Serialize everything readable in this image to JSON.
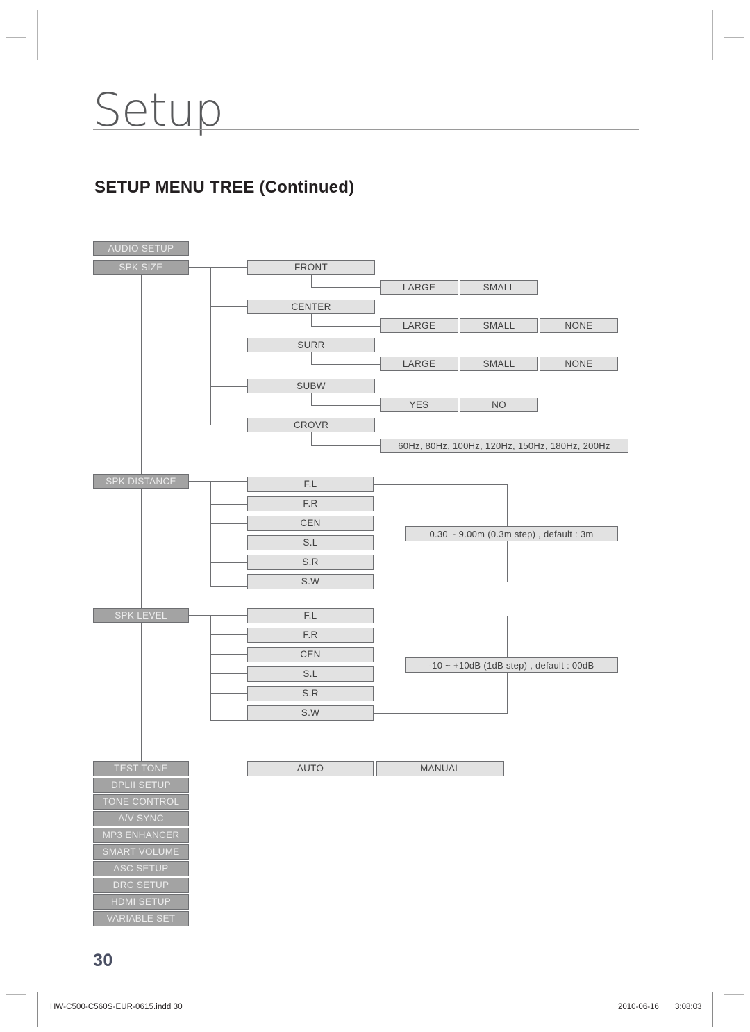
{
  "page": {
    "title": "Setup",
    "section_heading": "SETUP MENU TREE (Continued)",
    "number": "30"
  },
  "footer": {
    "file": "HW-C500-C560S-EUR-0615.indd   30",
    "date": "2010-06-16",
    "time": "3:08:03"
  },
  "colors": {
    "node_dark_fill": "#a3a3a3",
    "node_dark_text": "#ededed",
    "node_light_fill": "#e2e2e2",
    "node_light_text": "#3f3f3f",
    "node_border": "#6d6e71",
    "rule": "#9a9a9a",
    "page_number": "#4a4f63"
  },
  "tree": {
    "root": "AUDIO SETUP",
    "branches": [
      {
        "id": "spk-size",
        "label": "SPK SIZE",
        "children": [
          {
            "id": "front",
            "label": "FRONT",
            "options": [
              "LARGE",
              "SMALL"
            ]
          },
          {
            "id": "center",
            "label": "CENTER",
            "options": [
              "LARGE",
              "SMALL",
              "NONE"
            ]
          },
          {
            "id": "surr",
            "label": "SURR",
            "options": [
              "LARGE",
              "SMALL",
              "NONE"
            ]
          },
          {
            "id": "subw",
            "label": "SUBW",
            "options": [
              "YES",
              "NO"
            ]
          },
          {
            "id": "crovr",
            "label": "CROVR",
            "options": [
              "60Hz, 80Hz, 100Hz, 120Hz, 150Hz, 180Hz, 200Hz"
            ]
          }
        ]
      },
      {
        "id": "spk-distance",
        "label": "SPK DISTANCE",
        "children": [
          {
            "id": "dist-fl",
            "label": "F.L"
          },
          {
            "id": "dist-fr",
            "label": "F.R"
          },
          {
            "id": "dist-cen",
            "label": "CEN"
          },
          {
            "id": "dist-sl",
            "label": "S.L"
          },
          {
            "id": "dist-sr",
            "label": "S.R"
          },
          {
            "id": "dist-sw",
            "label": "S.W"
          }
        ],
        "range": "0.30 ~ 9.00m (0.3m step) , default : 3m"
      },
      {
        "id": "spk-level",
        "label": "SPK LEVEL",
        "children": [
          {
            "id": "lvl-fl",
            "label": "F.L"
          },
          {
            "id": "lvl-fr",
            "label": "F.R"
          },
          {
            "id": "lvl-cen",
            "label": "CEN"
          },
          {
            "id": "lvl-sl",
            "label": "S.L"
          },
          {
            "id": "lvl-sr",
            "label": "S.R"
          },
          {
            "id": "lvl-sw",
            "label": "S.W"
          }
        ],
        "range": "-10 ~ +10dB (1dB step) , default : 00dB"
      },
      {
        "id": "test-tone",
        "label": "TEST TONE",
        "options": [
          "AUTO",
          "MANUAL"
        ]
      }
    ],
    "menu_items": [
      "DPLII SETUP",
      "TONE CONTROL",
      "A/V SYNC",
      "MP3 ENHANCER",
      "SMART VOLUME",
      "ASC SETUP",
      "DRC SETUP",
      "HDMI SETUP",
      "VARIABLE SET"
    ]
  }
}
